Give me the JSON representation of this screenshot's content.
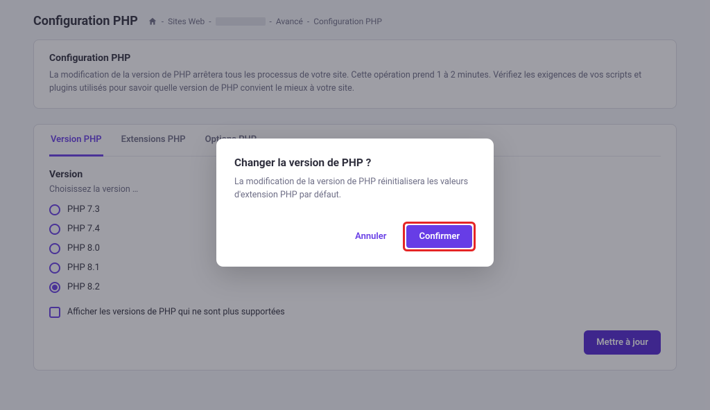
{
  "page_title": "Configuration PHP",
  "breadcrumbs": {
    "items": [
      "Sites Web",
      "",
      "Avancé",
      "Configuration PHP"
    ]
  },
  "info": {
    "title": "Configuration PHP",
    "text": "La modification de la version de PHP arrêtera tous les processus de votre site. Cette opération prend 1 à 2 minutes. Vérifiez les exigences de vos scripts et plugins utilisés pour savoir quelle version de PHP convient le mieux à votre site."
  },
  "tabs": {
    "items": [
      "Version PHP",
      "Extensions PHP",
      "Options PHP"
    ],
    "active_index": 0
  },
  "version_section": {
    "title": "Version",
    "subtitle": "Choisissez la version …",
    "options": [
      "PHP 7.3",
      "PHP 7.4",
      "PHP 8.0",
      "PHP 8.1",
      "PHP 8.2"
    ],
    "selected_index": 4,
    "checkbox_label": "Afficher les versions de PHP qui ne sont plus supportées",
    "checkbox_checked": false
  },
  "buttons": {
    "update": "Mettre à jour"
  },
  "modal": {
    "title": "Changer la version de PHP ?",
    "text": "La modification de la version de PHP réinitialisera les valeurs d'extension PHP par défaut.",
    "cancel": "Annuler",
    "confirm": "Confirmer"
  }
}
